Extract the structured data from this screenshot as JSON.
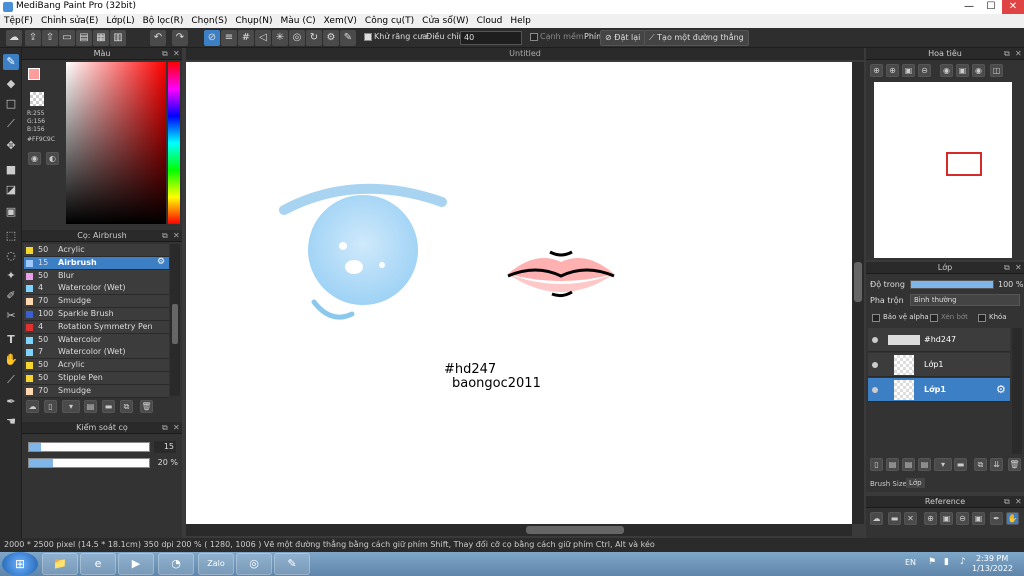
{
  "window": {
    "title": "MediBang Paint Pro (32bit)",
    "min": "—",
    "max": "☐",
    "close": "✕"
  },
  "menu": [
    "Tệp(F)",
    "Chỉnh sửa(E)",
    "Lớp(L)",
    "Bộ lọc(R)",
    "Chọn(S)",
    "Chụp(N)",
    "Màu (C)",
    "Xem(V)",
    "Công cụ(T)",
    "Cửa sổ(W)",
    "Cloud",
    "Help"
  ],
  "toolbar": {
    "antialias_label": "Khử răng cưa",
    "adjust_label": "Điều chỉnh",
    "adjust_value": "40",
    "edge_label": "Cạnh mềm",
    "key_label": "Phím",
    "reset_label": "Đặt lại",
    "create_line_label": "Tạo một đường thẳng"
  },
  "color_panel": {
    "title": "Màu",
    "rgb_r": "R:255",
    "rgb_g": "G:156",
    "rgb_b": "B:156",
    "hex": "#FF9C9C",
    "fg": "#ff9c9c"
  },
  "brush_panel": {
    "title": "Cọ: Airbrush",
    "items": [
      {
        "size": "50",
        "name": "Acrylic",
        "color": "#f5d631",
        "selected": false
      },
      {
        "size": "15",
        "name": "Airbrush",
        "color": "#a0c8ff",
        "selected": true
      },
      {
        "size": "50",
        "name": "Blur",
        "color": "#e8a0e8",
        "selected": false
      },
      {
        "size": "4",
        "name": "Watercolor (Wet)",
        "color": "#7fd4ff",
        "selected": false
      },
      {
        "size": "70",
        "name": "Smudge",
        "color": "#ffd7b0",
        "selected": false
      },
      {
        "size": "100",
        "name": "Sparkle Brush",
        "color": "#3a5fd0",
        "selected": false
      },
      {
        "size": "4",
        "name": "Rotation Symmetry Pen",
        "color": "#e03030",
        "selected": false
      },
      {
        "size": "50",
        "name": "Watercolor",
        "color": "#7fd4ff",
        "selected": false
      },
      {
        "size": "7",
        "name": "Watercolor (Wet)",
        "color": "#7fd4ff",
        "selected": false
      },
      {
        "size": "50",
        "name": "Acrylic",
        "color": "#f5d631",
        "selected": false
      },
      {
        "size": "50",
        "name": "Stipple Pen",
        "color": "#f5d631",
        "selected": false
      },
      {
        "size": "70",
        "name": "Smudge",
        "color": "#ffd7b0",
        "selected": false
      }
    ]
  },
  "brush_control": {
    "title": "Kiểm soát cọ",
    "size_value": "15",
    "size_fill": 0.1,
    "opacity_value": "20 %",
    "opacity_fill": 0.2
  },
  "canvas": {
    "tab": "Untitled",
    "text_line1": "#hd247",
    "text_line2": "baongoc2011"
  },
  "navigator": {
    "title": "Hoa tiêu"
  },
  "layer_panel": {
    "title": "Lớp",
    "opacity_label": "Độ trong",
    "opacity_value": "100 %",
    "blend_label": "Pha trộn",
    "blend_value": "Bình thường",
    "protect_alpha": "Bảo vệ alpha",
    "clip": "Xén bớt",
    "lock": "Khóa",
    "layers": [
      {
        "name": "#hd247",
        "selected": false
      },
      {
        "name": "Lớp1",
        "selected": false
      },
      {
        "name": "Lớp1",
        "selected": true
      }
    ],
    "tab1": "Brush Size",
    "tab2": "Lớp"
  },
  "reference": {
    "title": "Reference"
  },
  "status": {
    "text": "2000 * 2500 pixel  (14.5 * 18.1cm)  350 dpi  200 %  ( 1280, 1006 )  Vẽ một đường thẳng bằng cách giữ phím Shift, Thay đổi cỡ cọ bằng cách giữ phím Ctrl, Alt và kéo"
  },
  "taskbar": {
    "lang": "EN",
    "time": "2:39 PM",
    "date": "1/13/2022",
    "apps": [
      "folder-icon",
      "ie-icon",
      "media-icon",
      "app-icon",
      "zalo-icon",
      "chrome-icon",
      "paint-icon"
    ],
    "zalo_label": "Zalo"
  }
}
